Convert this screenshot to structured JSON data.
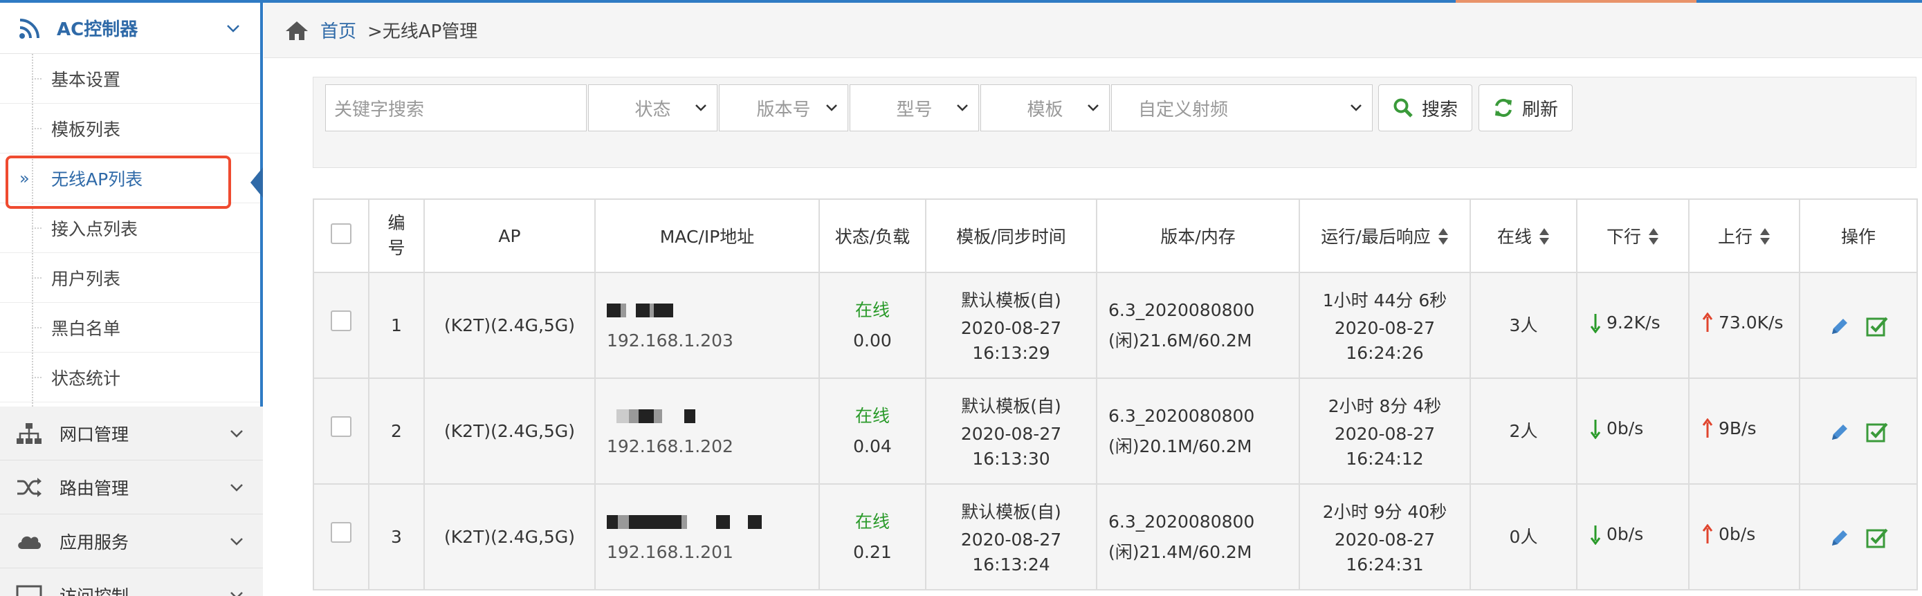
{
  "sidebar": {
    "ac_title": "AC控制器",
    "sub_items": [
      "基本设置",
      "模板列表",
      "无线AP列表",
      "接入点列表",
      "用户列表",
      "黑白名单",
      "状态统计"
    ],
    "active_index": 2,
    "active_arrow": "»",
    "menus": [
      {
        "label": "网口管理",
        "icon": "network-icon"
      },
      {
        "label": "路由管理",
        "icon": "shuffle-icon"
      },
      {
        "label": "应用服务",
        "icon": "cloud-icon"
      },
      {
        "label": "访问控制",
        "icon": "monitor-icon"
      }
    ]
  },
  "breadcrumb": {
    "home": "首页",
    "current": ">无线AP管理"
  },
  "filters": {
    "keyword_placeholder": "关键字搜索",
    "status": "状态",
    "version": "版本号",
    "model": "型号",
    "template": "模板",
    "custom_rf": "自定义射频",
    "search_label": "搜索",
    "refresh_label": "刷新"
  },
  "table": {
    "headers": {
      "num": "编号",
      "ap": "AP",
      "mac": "MAC/IP地址",
      "status": "状态/负载",
      "template": "模板/同步时间",
      "version": "版本/内存",
      "runtime": "运行/最后响应",
      "online": "在线",
      "down": "下行",
      "up": "上行",
      "ops": "操作"
    },
    "rows": [
      {
        "num": "1",
        "ap": "(K2T)(2.4G,5G)",
        "ip": "192.168.1.203",
        "status": "在线",
        "load": "0.00",
        "template": "默认模板(自)",
        "sync_date": "2020-08-27",
        "sync_time": "16:13:29",
        "version": "6.3_2020080800",
        "memory": "(闲)21.6M/60.2M",
        "runtime": "1小时 44分 6秒",
        "resp_date": "2020-08-27",
        "resp_time": "16:24:26",
        "online": "3人",
        "down": "9.2K/s",
        "up": "73.0K/s"
      },
      {
        "num": "2",
        "ap": "(K2T)(2.4G,5G)",
        "ip": "192.168.1.202",
        "status": "在线",
        "load": "0.04",
        "template": "默认模板(自)",
        "sync_date": "2020-08-27",
        "sync_time": "16:13:30",
        "version": "6.3_2020080800",
        "memory": "(闲)20.1M/60.2M",
        "runtime": "2小时 8分 4秒",
        "resp_date": "2020-08-27",
        "resp_time": "16:24:12",
        "online": "2人",
        "down": "0b/s",
        "up": "9B/s"
      },
      {
        "num": "3",
        "ap": "(K2T)(2.4G,5G)",
        "ip": "192.168.1.201",
        "status": "在线",
        "load": "0.21",
        "template": "默认模板(自)",
        "sync_date": "2020-08-27",
        "sync_time": "16:13:24",
        "version": "6.3_2020080800",
        "memory": "(闲)21.4M/60.2M",
        "runtime": "2小时 9分 40秒",
        "resp_date": "2020-08-27",
        "resp_time": "16:24:31",
        "online": "0人",
        "down": "0b/s",
        "up": "0b/s"
      }
    ]
  },
  "colors": {
    "accent": "#2f6aa8",
    "online_green": "#2a9a2a",
    "highlight_red": "#ef4b30",
    "down_arrow": "#2a9a2a",
    "up_arrow": "#e0452e"
  }
}
